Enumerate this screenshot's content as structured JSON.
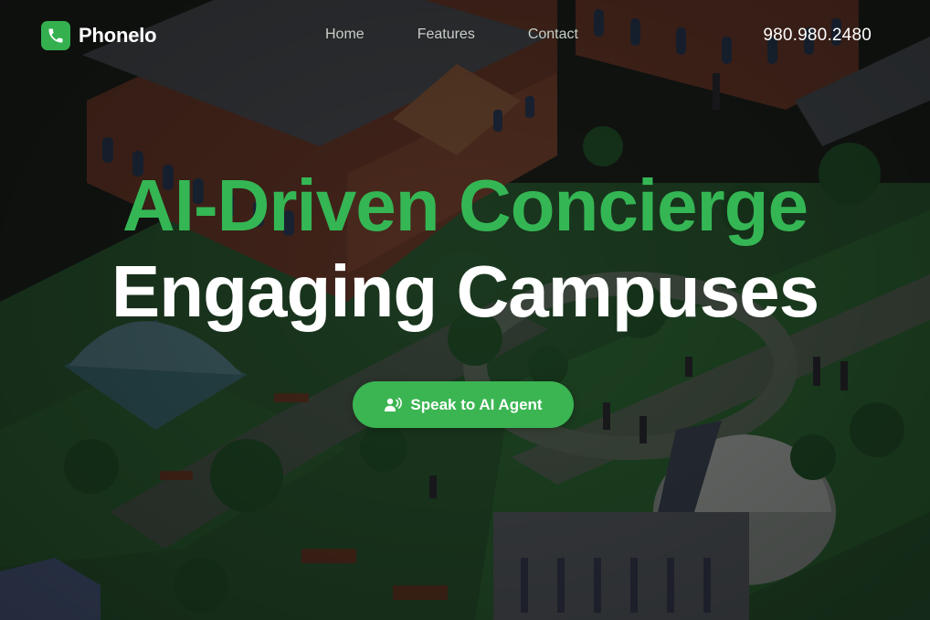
{
  "brand": {
    "name": "Phonelo",
    "icon": "phone-icon",
    "accent_color": "#34b04f"
  },
  "nav": {
    "links": [
      "Home",
      "Features",
      "Contact"
    ],
    "phone": "980.980.2480"
  },
  "hero": {
    "headline_accent": "AI-Driven Concierge",
    "headline_main": "Engaging Campuses",
    "cta_label": "Speak to AI Agent",
    "cta_icon": "voice-agent-icon",
    "background": "isometric-campus-illustration"
  },
  "colors": {
    "accent": "#35b654",
    "button": "#3bb552",
    "text": "#ffffff",
    "nav_text": "#c7cfc8"
  }
}
